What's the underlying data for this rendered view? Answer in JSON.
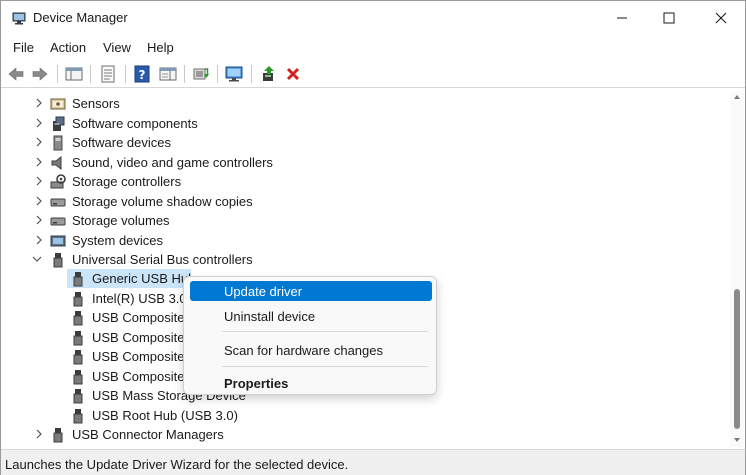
{
  "window": {
    "title": "Device Manager"
  },
  "menu": [
    "File",
    "Action",
    "View",
    "Help"
  ],
  "toolbar_icons": [
    "back-arrow-icon",
    "forward-arrow-icon",
    "show-hide-console-tree-icon",
    "properties-icon",
    "help-icon",
    "action-pane-icon",
    "update-driver-icon",
    "scan-hardware-icon",
    "enable-device-icon",
    "uninstall-icon"
  ],
  "tree": {
    "categories": [
      {
        "label": "Sensors",
        "icon": "sensors-icon",
        "expanded": false
      },
      {
        "label": "Software components",
        "icon": "software-components-icon",
        "expanded": false
      },
      {
        "label": "Software devices",
        "icon": "software-devices-icon",
        "expanded": false
      },
      {
        "label": "Sound, video and game controllers",
        "icon": "speaker-icon",
        "expanded": false
      },
      {
        "label": "Storage controllers",
        "icon": "storage-controller-icon",
        "expanded": false
      },
      {
        "label": "Storage volume shadow copies",
        "icon": "drive-icon",
        "expanded": false
      },
      {
        "label": "Storage volumes",
        "icon": "drive-icon",
        "expanded": false
      },
      {
        "label": "System devices",
        "icon": "system-devices-icon",
        "expanded": false
      },
      {
        "label": "Universal Serial Bus controllers",
        "icon": "usb-icon",
        "expanded": true
      }
    ],
    "usb_children": [
      {
        "label": "Generic USB Hub",
        "selected": true
      },
      {
        "label": "Intel(R) USB 3.0 e",
        "selected": false
      },
      {
        "label": "USB Composite",
        "selected": false
      },
      {
        "label": "USB Composite",
        "selected": false
      },
      {
        "label": "USB Composite",
        "selected": false
      },
      {
        "label": "USB Composite",
        "selected": false
      },
      {
        "label": "USB Mass Storage Device",
        "selected": false
      },
      {
        "label": "USB Root Hub (USB 3.0)",
        "selected": false
      }
    ],
    "after": [
      {
        "label": "USB Connector Managers",
        "icon": "usb-icon",
        "expanded": false
      }
    ]
  },
  "context_menu": {
    "update": "Update driver",
    "uninstall": "Uninstall device",
    "scan": "Scan for hardware changes",
    "properties": "Properties"
  },
  "status": "Launches the Update Driver Wizard for the selected device.",
  "colors": {
    "accent": "#0078d4",
    "selection": "#cce4f7",
    "uninstall_red": "#d32020"
  }
}
